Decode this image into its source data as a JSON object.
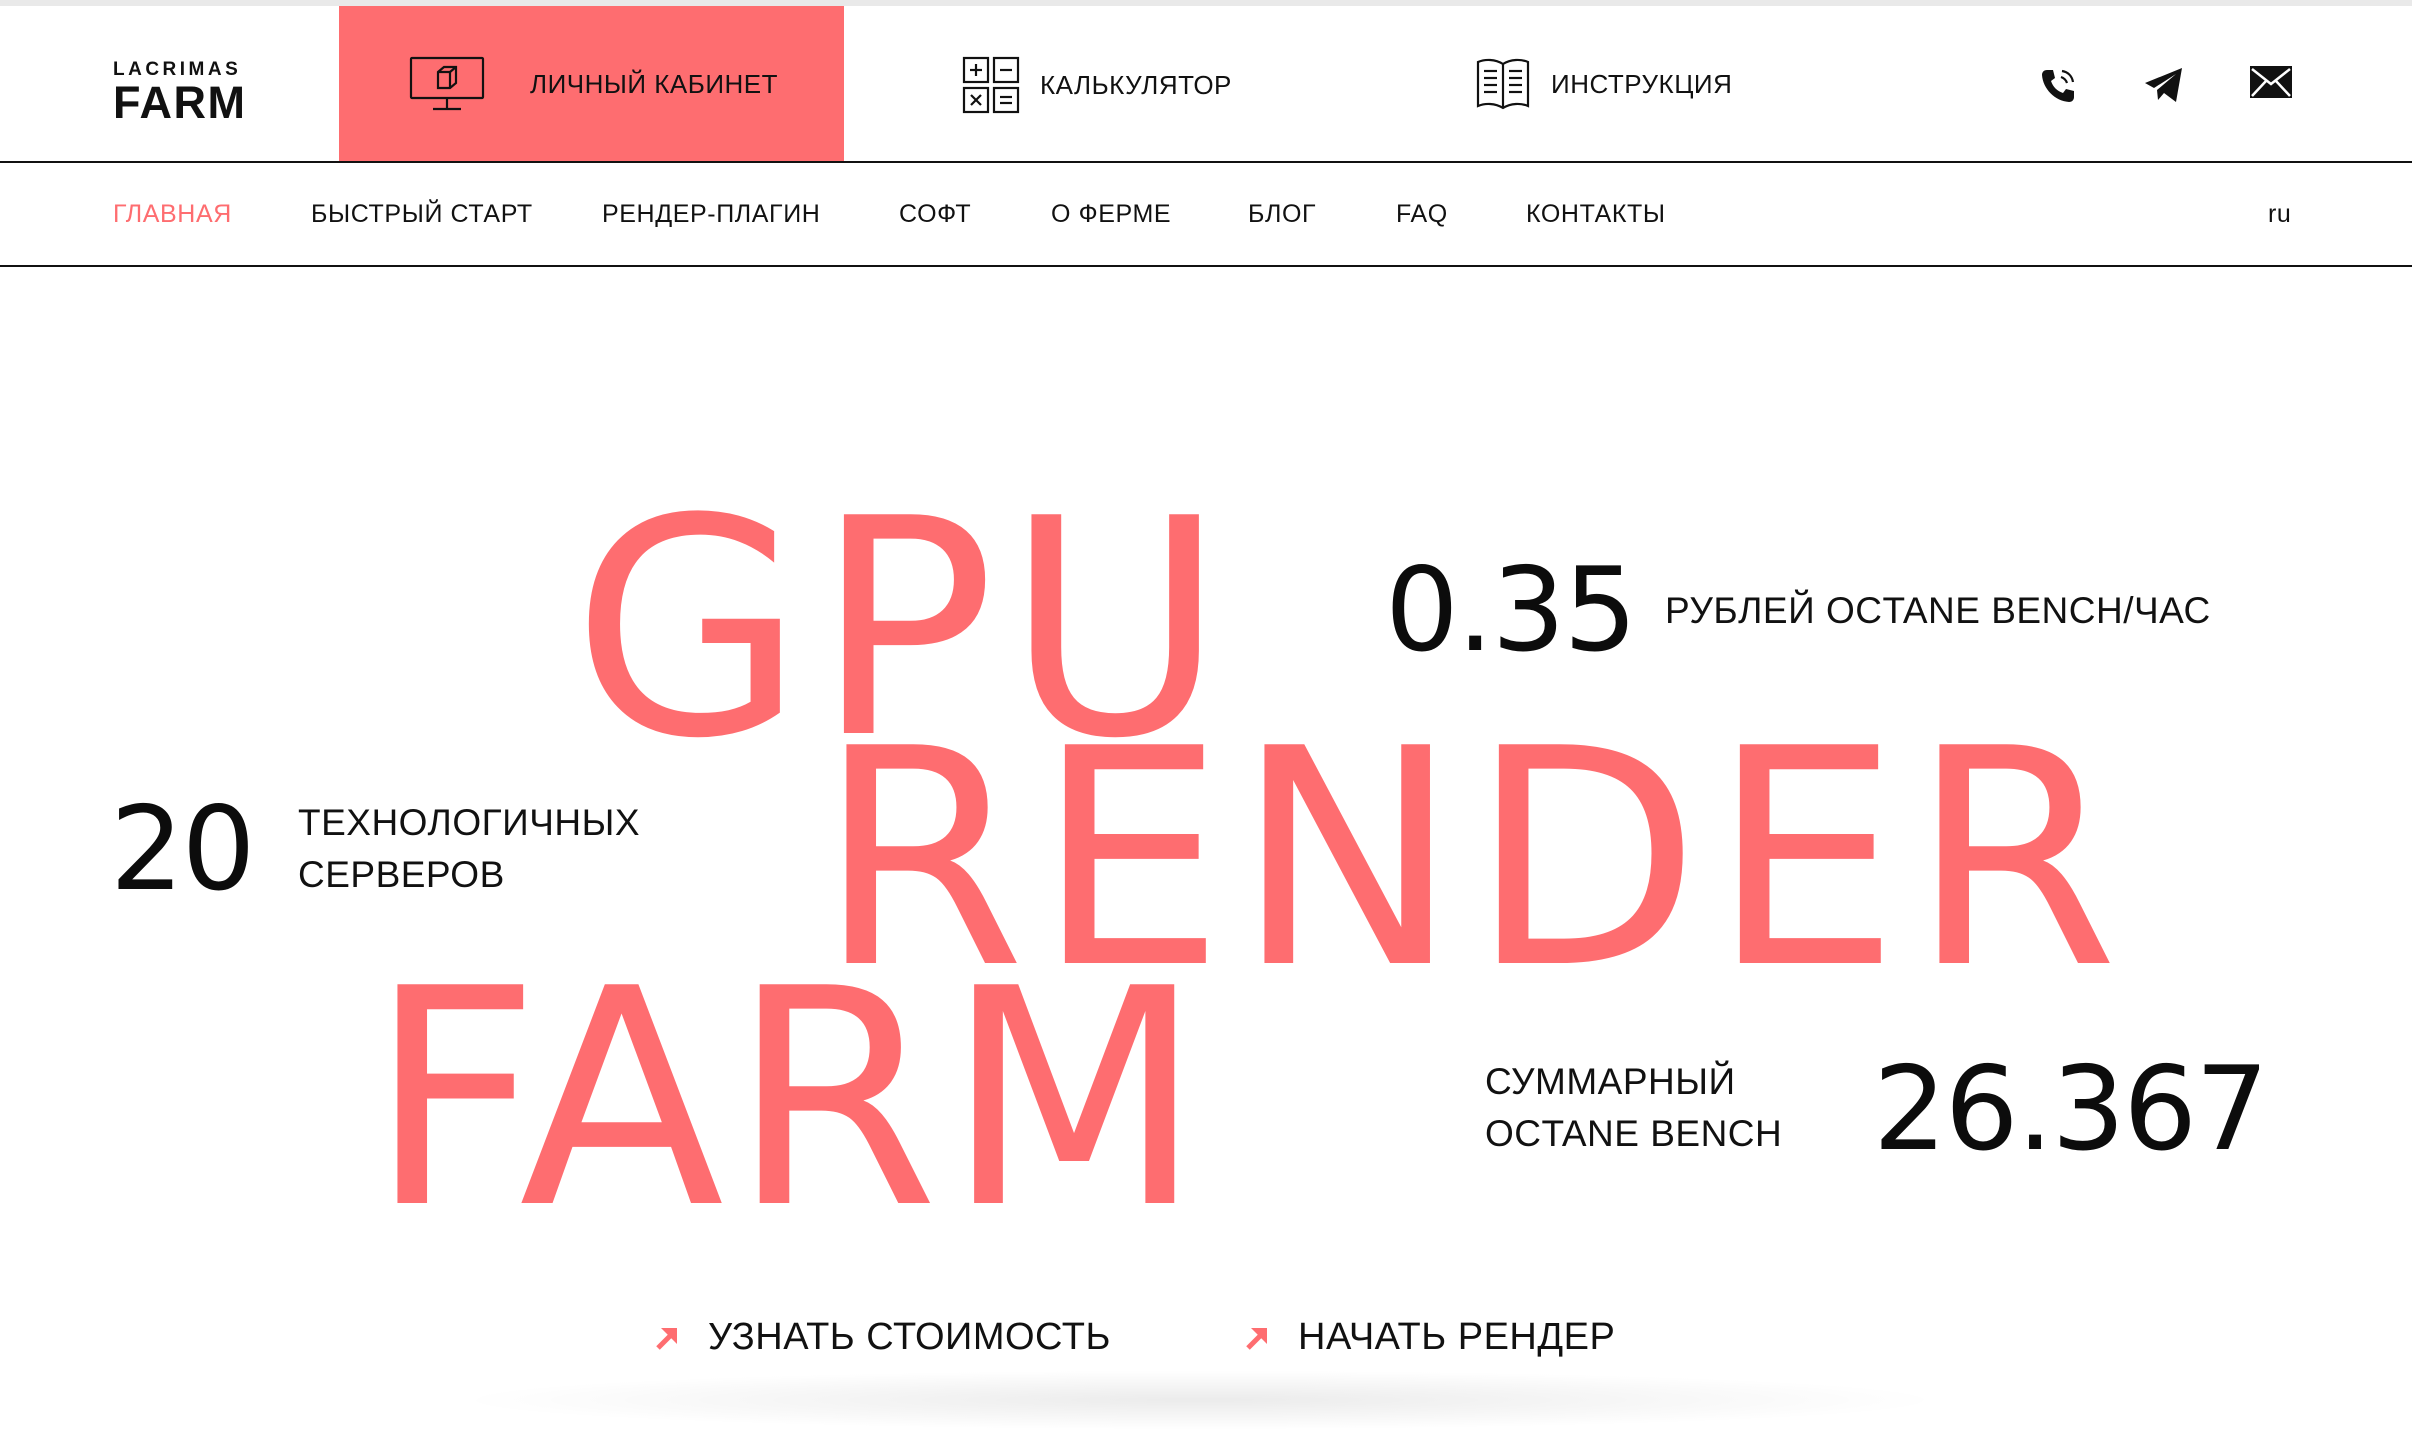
{
  "logo": {
    "top": "LACRIMAS",
    "bottom": "FARM"
  },
  "header": {
    "cabinet_label": "ЛИЧНЫЙ КАБИНЕТ",
    "calculator_label": "КАЛЬКУЛЯТОР",
    "instruction_label": "ИНСТРУКЦИЯ",
    "icons": [
      "monitor-cube-icon",
      "calculator-icon",
      "book-icon",
      "phone-icon",
      "telegram-icon",
      "mail-icon"
    ]
  },
  "nav": {
    "items": [
      {
        "label": "ГЛАВНАЯ",
        "active": true
      },
      {
        "label": "БЫСТРЫЙ СТАРТ"
      },
      {
        "label": "РЕНДЕР-ПЛАГИН"
      },
      {
        "label": "СОФТ"
      },
      {
        "label": "О ФЕРМЕ"
      },
      {
        "label": "БЛОГ"
      },
      {
        "label": "FAQ"
      },
      {
        "label": "КОНТАКТЫ"
      }
    ],
    "language": "ru"
  },
  "hero": {
    "line1": "GPU",
    "line2": "RENDER",
    "line3": "FARM",
    "stats": [
      {
        "value": "0.35",
        "text": "РУБЛЕЙ OCTANE BENCH/ЧАС"
      },
      {
        "value": "20",
        "line1": "ТЕХНОЛОГИЧНЫХ",
        "line2": "СЕРВЕРОВ"
      },
      {
        "value": "26.367",
        "line1": "СУММАРНЫЙ",
        "line2": "OCTANE BENCH"
      }
    ],
    "cta": [
      {
        "label": "УЗНАТЬ СТОИМОСТЬ"
      },
      {
        "label": "НАЧАТЬ РЕНДЕР"
      }
    ]
  },
  "colors": {
    "accent": "#fe6d70",
    "text": "#111111",
    "background": "#ffffff"
  }
}
